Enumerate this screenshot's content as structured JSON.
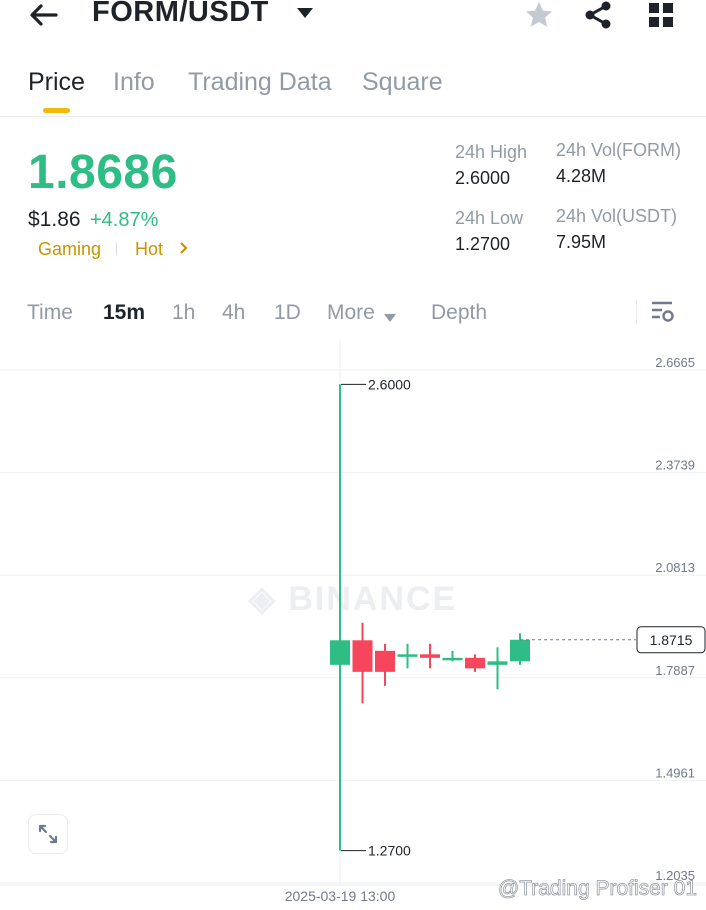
{
  "header": {
    "pair": "FORM/USDT",
    "icons": [
      "back-arrow-icon",
      "caret-down-icon",
      "star-icon",
      "share-icon",
      "grid-icon"
    ]
  },
  "tabs": [
    {
      "label": "Price",
      "active": true
    },
    {
      "label": "Info",
      "active": false
    },
    {
      "label": "Trading Data",
      "active": false
    },
    {
      "label": "Square",
      "active": false
    }
  ],
  "ticker": {
    "last_price": "1.8686",
    "fiat_price": "$1.86",
    "change_pct": "+4.87%",
    "tags": [
      "Gaming",
      "Hot"
    ]
  },
  "stats": {
    "high_label": "24h High",
    "high_value": "2.6000",
    "low_label": "24h Low",
    "low_value": "1.2700",
    "vol_base_label": "24h Vol(FORM)",
    "vol_base_value": "4.28M",
    "vol_quote_label": "24h Vol(USDT)",
    "vol_quote_value": "7.95M"
  },
  "chart_tabs": [
    {
      "label": "Time",
      "active": false
    },
    {
      "label": "15m",
      "active": true
    },
    {
      "label": "1h",
      "active": false
    },
    {
      "label": "4h",
      "active": false
    },
    {
      "label": "1D",
      "active": false
    },
    {
      "label": "More",
      "active": false
    },
    {
      "label": "Depth",
      "active": false
    }
  ],
  "colors": {
    "up": "#2ebd85",
    "down": "#f6465d",
    "accent": "#f0b90b"
  },
  "chart_data": {
    "type": "candlestick",
    "interval": "15m",
    "y_ticks": [
      "2.6665",
      "2.3739",
      "2.0813",
      "1.7887",
      "1.4961",
      "1.2035"
    ],
    "x_label": "2025-03-19 13:00",
    "ylim": [
      1.2035,
      2.6665
    ],
    "candles": [
      {
        "open": 1.8,
        "high": 2.6,
        "low": 1.27,
        "close": 1.87
      },
      {
        "open": 1.87,
        "high": 1.92,
        "low": 1.69,
        "close": 1.78
      },
      {
        "open": 1.84,
        "high": 1.86,
        "low": 1.74,
        "close": 1.78
      },
      {
        "open": 1.83,
        "high": 1.86,
        "low": 1.79,
        "close": 1.83
      },
      {
        "open": 1.83,
        "high": 1.86,
        "low": 1.79,
        "close": 1.82
      },
      {
        "open": 1.82,
        "high": 1.84,
        "low": 1.81,
        "close": 1.82
      },
      {
        "open": 1.82,
        "high": 1.83,
        "low": 1.78,
        "close": 1.79
      },
      {
        "open": 1.8,
        "high": 1.85,
        "low": 1.73,
        "close": 1.81
      },
      {
        "open": 1.81,
        "high": 1.89,
        "low": 1.8,
        "close": 1.8715
      }
    ],
    "high_marker": "2.6000",
    "low_marker": "1.2700",
    "last_price_label": "1.8715",
    "watermark": "BINANCE",
    "credit": "@Trading Profiser 01"
  }
}
